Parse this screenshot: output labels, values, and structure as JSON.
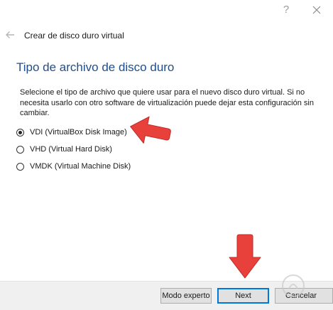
{
  "window": {
    "help_glyph": "?",
    "close_icon": "close-icon"
  },
  "header": {
    "title": "Crear de disco duro virtual"
  },
  "section": {
    "title": "Tipo de archivo de disco duro",
    "description": "Selecione el tipo de archivo que quiere usar para el nuevo disco duro virtual. Si no necesita usarlo con otro software de virtualización puede dejar esta configuración sin cambiar."
  },
  "options": [
    {
      "label": "VDI (VirtualBox Disk Image)",
      "checked": true
    },
    {
      "label": "VHD (Virtual Hard Disk)",
      "checked": false
    },
    {
      "label": "VMDK (Virtual Machine Disk)",
      "checked": false
    }
  ],
  "footer": {
    "expert_label": "Modo experto",
    "next_label": "Next",
    "cancel_label": "Cancelar"
  },
  "colors": {
    "section_title": "#1f4e8c",
    "annotation_arrow": "#e8413c",
    "focus_border": "#0078d7"
  }
}
